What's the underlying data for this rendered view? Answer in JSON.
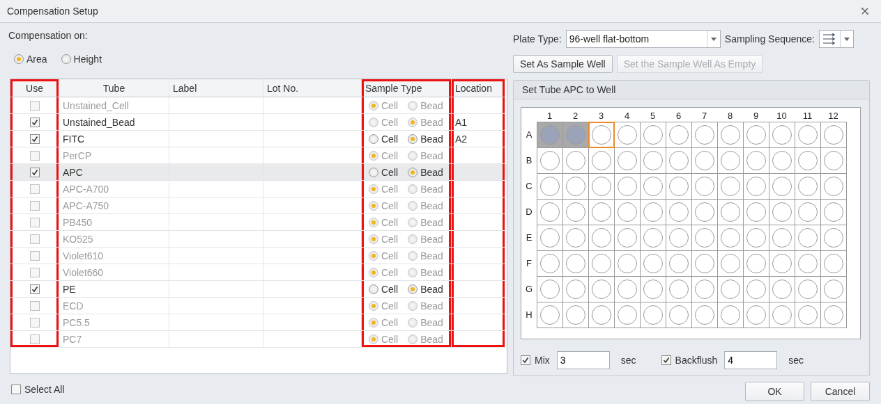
{
  "window": {
    "title": "Compensation Setup"
  },
  "compensation": {
    "label": "Compensation on:",
    "options": [
      {
        "label": "Area",
        "selected": true
      },
      {
        "label": "Height",
        "selected": false
      }
    ]
  },
  "table": {
    "columns": [
      {
        "label": "Use",
        "annotated": true
      },
      {
        "label": "Tube",
        "annotated": false
      },
      {
        "label": "Label",
        "annotated": false
      },
      {
        "label": "Lot No.",
        "annotated": false
      },
      {
        "label": "Sample Type",
        "annotated": true
      },
      {
        "label": "Location",
        "annotated": true
      }
    ],
    "rows": [
      {
        "use": false,
        "tube": "Unstained_Cell",
        "sample_type": [
          {
            "label": "Cell",
            "selected": true
          },
          {
            "label": "Bead",
            "selected": false
          }
        ],
        "sample_disabled": true,
        "selected": false
      },
      {
        "use": true,
        "tube": "Unstained_Bead",
        "sample_type": [
          {
            "label": "Cell",
            "selected": false
          },
          {
            "label": "Bead",
            "selected": true
          }
        ],
        "sample_disabled": true,
        "location": "A1",
        "selected": false
      },
      {
        "use": true,
        "tube": "FITC",
        "sample_type": [
          {
            "label": "Cell",
            "selected": false
          },
          {
            "label": "Bead",
            "selected": true
          }
        ],
        "sample_disabled": false,
        "location": "A2",
        "selected": false
      },
      {
        "use": false,
        "tube": "PerCP",
        "sample_type": [
          {
            "label": "Cell",
            "selected": true
          },
          {
            "label": "Bead",
            "selected": false
          }
        ],
        "sample_disabled": true,
        "selected": false
      },
      {
        "use": true,
        "tube": "APC",
        "sample_type": [
          {
            "label": "Cell",
            "selected": false
          },
          {
            "label": "Bead",
            "selected": true
          }
        ],
        "sample_disabled": false,
        "selected": true
      },
      {
        "use": false,
        "tube": "APC-A700",
        "sample_type": [
          {
            "label": "Cell",
            "selected": true
          },
          {
            "label": "Bead",
            "selected": false
          }
        ],
        "sample_disabled": true,
        "selected": false
      },
      {
        "use": false,
        "tube": "APC-A750",
        "sample_type": [
          {
            "label": "Cell",
            "selected": true
          },
          {
            "label": "Bead",
            "selected": false
          }
        ],
        "sample_disabled": true,
        "selected": false
      },
      {
        "use": false,
        "tube": "PB450",
        "sample_type": [
          {
            "label": "Cell",
            "selected": true
          },
          {
            "label": "Bead",
            "selected": false
          }
        ],
        "sample_disabled": true,
        "selected": false
      },
      {
        "use": false,
        "tube": "KO525",
        "sample_type": [
          {
            "label": "Cell",
            "selected": true
          },
          {
            "label": "Bead",
            "selected": false
          }
        ],
        "sample_disabled": true,
        "selected": false
      },
      {
        "use": false,
        "tube": "Violet610",
        "sample_type": [
          {
            "label": "Cell",
            "selected": true
          },
          {
            "label": "Bead",
            "selected": false
          }
        ],
        "sample_disabled": true,
        "selected": false
      },
      {
        "use": false,
        "tube": "Violet660",
        "sample_type": [
          {
            "label": "Cell",
            "selected": true
          },
          {
            "label": "Bead",
            "selected": false
          }
        ],
        "sample_disabled": true,
        "selected": false
      },
      {
        "use": true,
        "tube": "PE",
        "sample_type": [
          {
            "label": "Cell",
            "selected": false
          },
          {
            "label": "Bead",
            "selected": true
          }
        ],
        "sample_disabled": false,
        "selected": false
      },
      {
        "use": false,
        "tube": "ECD",
        "sample_type": [
          {
            "label": "Cell",
            "selected": true
          },
          {
            "label": "Bead",
            "selected": false
          }
        ],
        "sample_disabled": true,
        "selected": false
      },
      {
        "use": false,
        "tube": "PC5.5",
        "sample_type": [
          {
            "label": "Cell",
            "selected": true
          },
          {
            "label": "Bead",
            "selected": false
          }
        ],
        "sample_disabled": true,
        "selected": false
      },
      {
        "use": false,
        "tube": "PC7",
        "sample_type": [
          {
            "label": "Cell",
            "selected": true
          },
          {
            "label": "Bead",
            "selected": false
          }
        ],
        "sample_disabled": true,
        "selected": false
      }
    ]
  },
  "select_all": {
    "label": "Select All",
    "checked": false
  },
  "plate_type": {
    "label": "Plate Type:",
    "value": "96-well flat-bottom"
  },
  "sampling_sequence": {
    "label": "Sampling Sequence:"
  },
  "buttons": [
    {
      "label": "Set As Sample Well",
      "disabled": false
    },
    {
      "label": "Set the Sample Well As Empty",
      "disabled": true
    }
  ],
  "plate": {
    "title": "Set Tube APC to Well",
    "columns": [
      "1",
      "2",
      "3",
      "4",
      "5",
      "6",
      "7",
      "8",
      "9",
      "10",
      "11",
      "12"
    ],
    "rows": [
      {
        "label": "A",
        "filled": [
          true,
          true,
          false,
          false,
          false,
          false,
          false,
          false,
          false,
          false,
          false,
          false
        ],
        "current": [
          false,
          false,
          true,
          false,
          false,
          false,
          false,
          false,
          false,
          false,
          false,
          false
        ]
      },
      {
        "label": "B",
        "filled": [
          false,
          false,
          false,
          false,
          false,
          false,
          false,
          false,
          false,
          false,
          false,
          false
        ],
        "current": [
          false,
          false,
          false,
          false,
          false,
          false,
          false,
          false,
          false,
          false,
          false,
          false
        ]
      },
      {
        "label": "C",
        "filled": [
          false,
          false,
          false,
          false,
          false,
          false,
          false,
          false,
          false,
          false,
          false,
          false
        ],
        "current": [
          false,
          false,
          false,
          false,
          false,
          false,
          false,
          false,
          false,
          false,
          false,
          false
        ]
      },
      {
        "label": "D",
        "filled": [
          false,
          false,
          false,
          false,
          false,
          false,
          false,
          false,
          false,
          false,
          false,
          false
        ],
        "current": [
          false,
          false,
          false,
          false,
          false,
          false,
          false,
          false,
          false,
          false,
          false,
          false
        ]
      },
      {
        "label": "E",
        "filled": [
          false,
          false,
          false,
          false,
          false,
          false,
          false,
          false,
          false,
          false,
          false,
          false
        ],
        "current": [
          false,
          false,
          false,
          false,
          false,
          false,
          false,
          false,
          false,
          false,
          false,
          false
        ]
      },
      {
        "label": "F",
        "filled": [
          false,
          false,
          false,
          false,
          false,
          false,
          false,
          false,
          false,
          false,
          false,
          false
        ],
        "current": [
          false,
          false,
          false,
          false,
          false,
          false,
          false,
          false,
          false,
          false,
          false,
          false
        ]
      },
      {
        "label": "G",
        "filled": [
          false,
          false,
          false,
          false,
          false,
          false,
          false,
          false,
          false,
          false,
          false,
          false
        ],
        "current": [
          false,
          false,
          false,
          false,
          false,
          false,
          false,
          false,
          false,
          false,
          false,
          false
        ]
      },
      {
        "label": "H",
        "filled": [
          false,
          false,
          false,
          false,
          false,
          false,
          false,
          false,
          false,
          false,
          false,
          false
        ],
        "current": [
          false,
          false,
          false,
          false,
          false,
          false,
          false,
          false,
          false,
          false,
          false,
          false
        ]
      }
    ]
  },
  "mix": {
    "label": "Mix",
    "checked": true,
    "value": "3",
    "unit": "sec"
  },
  "backflush": {
    "label": "Backflush",
    "checked": true,
    "value": "4",
    "unit": "sec"
  },
  "dialog_buttons": [
    "OK",
    "Cancel"
  ]
}
